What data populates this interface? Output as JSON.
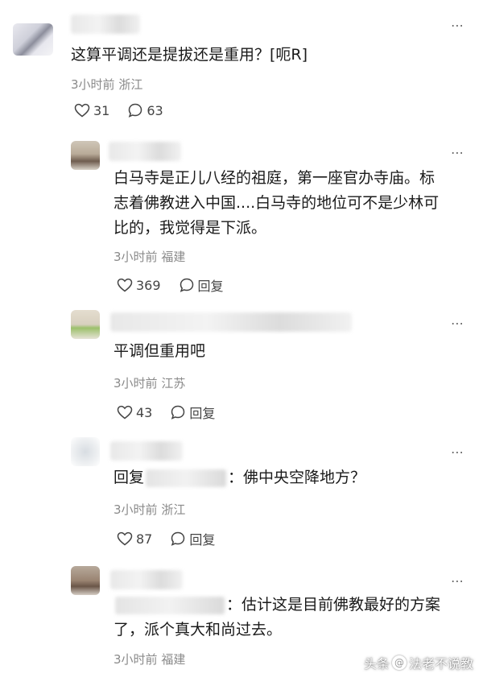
{
  "comments": [
    {
      "text": "这算平调还是提拔还是重用？[呃R]",
      "time": "3小时前",
      "location": "浙江",
      "likes": "31",
      "replies": "63",
      "more_label": "⋯"
    },
    {
      "text_lines": [
        "白马寺是正儿八经的祖庭，第一座官办寺庙。标",
        "志着佛教进入中国....白马寺的地位可不是少林可",
        "比的，我觉得是下派。"
      ],
      "time": "3小时前",
      "location": "福建",
      "likes": "369",
      "reply_label": "回复",
      "more_label": "⋯"
    },
    {
      "text": "平调但重用吧",
      "time": "3小时前",
      "location": "江苏",
      "likes": "43",
      "reply_label": "回复",
      "more_label": "⋯"
    },
    {
      "reply_prefix": "回复",
      "text": "：佛中央空降地方？",
      "time": "3小时前",
      "location": "浙江",
      "likes": "87",
      "reply_label": "回复",
      "more_label": "⋯"
    },
    {
      "text_line1": "：估计这是目前佛教最好的方案",
      "text_line2": "了，派个真大和尚过去。",
      "time": "3小时前",
      "location": "福建",
      "more_label": "⋯"
    }
  ],
  "watermark": {
    "prefix": "头条",
    "at": "@",
    "account": "法老不说教"
  },
  "icons": {
    "like": "heart-outline",
    "reply": "speech-bubble-outline"
  }
}
